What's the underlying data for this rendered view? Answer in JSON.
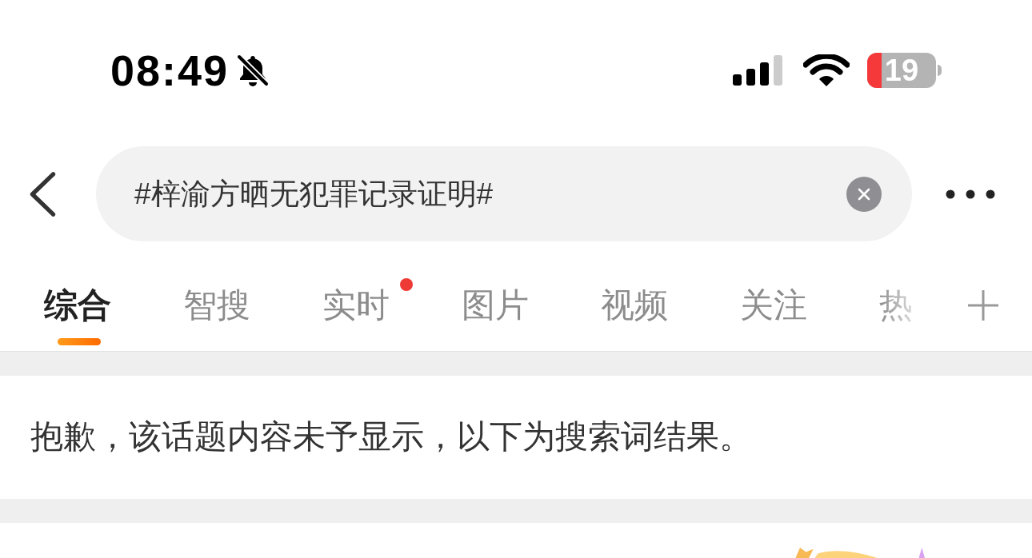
{
  "status_bar": {
    "time": "08:49",
    "silent": true,
    "battery": "19"
  },
  "search": {
    "value": "#梓渝方晒无犯罪记录证明#"
  },
  "tabs": [
    {
      "label": "综合",
      "selected": true,
      "dot": false
    },
    {
      "label": "智搜",
      "selected": false,
      "dot": false
    },
    {
      "label": "实时",
      "selected": false,
      "dot": true
    },
    {
      "label": "图片",
      "selected": false,
      "dot": false
    },
    {
      "label": "视频",
      "selected": false,
      "dot": false
    },
    {
      "label": "关注",
      "selected": false,
      "dot": false
    },
    {
      "label": "热",
      "selected": false,
      "dot": false
    }
  ],
  "notice": "抱歉，该话题内容未予显示，以下为搜索词结果。"
}
